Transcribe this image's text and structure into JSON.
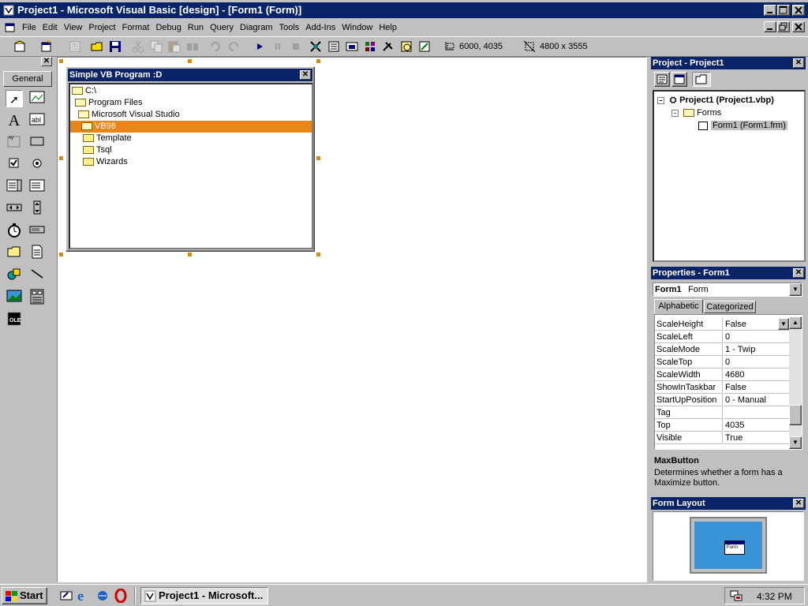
{
  "window": {
    "title": "Project1 - Microsoft Visual Basic [design] - [Form1 (Form)]"
  },
  "menu": [
    "File",
    "Edit",
    "View",
    "Project",
    "Format",
    "Debug",
    "Run",
    "Query",
    "Diagram",
    "Tools",
    "Add-Ins",
    "Window",
    "Help"
  ],
  "toolbar": {
    "position": "6000, 4035",
    "size": "4800 x 3555"
  },
  "toolbox": {
    "tab_label": "General"
  },
  "form": {
    "title": "Simple VB Program :D",
    "tree": [
      {
        "label": "C:\\",
        "icon": "open-folder-icon"
      },
      {
        "label": "Program Files",
        "icon": "open-folder-icon"
      },
      {
        "label": "Microsoft Visual Studio",
        "icon": "open-folder-icon"
      },
      {
        "label": "VB98",
        "icon": "open-folder-icon",
        "selected": true
      },
      {
        "label": "Template",
        "icon": "folder-icon"
      },
      {
        "label": "Tsql",
        "icon": "folder-icon"
      },
      {
        "label": "Wizards",
        "icon": "folder-icon"
      }
    ],
    "selection_color": "#e8861a"
  },
  "project_panel": {
    "title": "Project - Project1",
    "root": "Project1 (Project1.vbp)",
    "folder": "Forms",
    "item": "Form1 (Form1.frm)"
  },
  "properties_panel": {
    "title": "Properties - Form1",
    "object_name": "Form1",
    "object_type": "Form",
    "tabs": [
      "Alphabetic",
      "Categorized"
    ],
    "rows": [
      {
        "name": "ScaleHeight",
        "value": "False"
      },
      {
        "name": "ScaleLeft",
        "value": "0"
      },
      {
        "name": "ScaleMode",
        "value": "1 - Twip"
      },
      {
        "name": "ScaleTop",
        "value": "0"
      },
      {
        "name": "ScaleWidth",
        "value": "4680"
      },
      {
        "name": "ShowInTaskbar",
        "value": "False"
      },
      {
        "name": "StartUpPosition",
        "value": "0 - Manual"
      },
      {
        "name": "Tag",
        "value": ""
      },
      {
        "name": "Top",
        "value": "4035"
      },
      {
        "name": "Visible",
        "value": "True"
      }
    ],
    "desc_title": "MaxButton",
    "desc_text": "Determines whether a form has a Maximize button."
  },
  "layout_panel": {
    "title": "Form Layout",
    "form_label": "Form"
  },
  "taskbar": {
    "start_label": "Start",
    "task_label": "Project1 - Microsoft...",
    "clock": "4:32 PM"
  },
  "colors": {
    "title_active": "#0a246a",
    "desktop_preview": "#3a94d8"
  }
}
